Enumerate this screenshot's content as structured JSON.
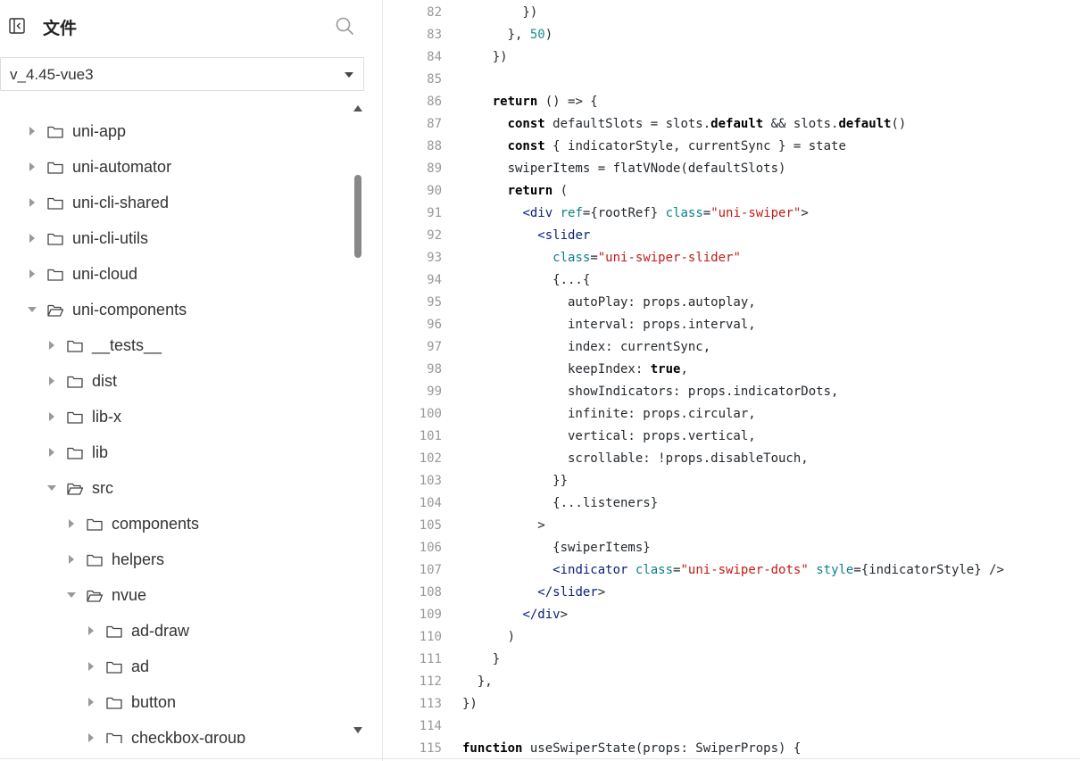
{
  "sidebar": {
    "title": "文件",
    "branch": "v_4.45-vue3",
    "tree": [
      {
        "label": "uni-app",
        "depth": 0,
        "expanded": false
      },
      {
        "label": "uni-automator",
        "depth": 0,
        "expanded": false
      },
      {
        "label": "uni-cli-shared",
        "depth": 0,
        "expanded": false
      },
      {
        "label": "uni-cli-utils",
        "depth": 0,
        "expanded": false
      },
      {
        "label": "uni-cloud",
        "depth": 0,
        "expanded": false
      },
      {
        "label": "uni-components",
        "depth": 0,
        "expanded": true
      },
      {
        "label": "__tests__",
        "depth": 1,
        "expanded": false
      },
      {
        "label": "dist",
        "depth": 1,
        "expanded": false
      },
      {
        "label": "lib-x",
        "depth": 1,
        "expanded": false
      },
      {
        "label": "lib",
        "depth": 1,
        "expanded": false
      },
      {
        "label": "src",
        "depth": 1,
        "expanded": true
      },
      {
        "label": "components",
        "depth": 2,
        "expanded": false
      },
      {
        "label": "helpers",
        "depth": 2,
        "expanded": false
      },
      {
        "label": "nvue",
        "depth": 2,
        "expanded": true
      },
      {
        "label": "ad-draw",
        "depth": 3,
        "expanded": false
      },
      {
        "label": "ad",
        "depth": 3,
        "expanded": false
      },
      {
        "label": "button",
        "depth": 3,
        "expanded": false
      },
      {
        "label": "checkbox-group",
        "depth": 3,
        "expanded": false
      }
    ]
  },
  "code": {
    "lines": [
      {
        "n": "82",
        "t": "        })"
      },
      {
        "n": "83",
        "t": "      }, 50)"
      },
      {
        "n": "84",
        "t": "    })"
      },
      {
        "n": "85",
        "t": ""
      },
      {
        "n": "86",
        "t": "    return () => {"
      },
      {
        "n": "87",
        "t": "      const defaultSlots = slots.default && slots.default()"
      },
      {
        "n": "88",
        "t": "      const { indicatorStyle, currentSync } = state"
      },
      {
        "n": "89",
        "t": "      swiperItems = flatVNode(defaultSlots)"
      },
      {
        "n": "90",
        "t": "      return ("
      },
      {
        "n": "91",
        "t": "        <div ref={rootRef} class=\"uni-swiper\">"
      },
      {
        "n": "92",
        "t": "          <slider"
      },
      {
        "n": "93",
        "t": "            class=\"uni-swiper-slider\""
      },
      {
        "n": "94",
        "t": "            {...{"
      },
      {
        "n": "95",
        "t": "              autoPlay: props.autoplay,"
      },
      {
        "n": "96",
        "t": "              interval: props.interval,"
      },
      {
        "n": "97",
        "t": "              index: currentSync,"
      },
      {
        "n": "98",
        "t": "              keepIndex: true,"
      },
      {
        "n": "99",
        "t": "              showIndicators: props.indicatorDots,"
      },
      {
        "n": "100",
        "t": "              infinite: props.circular,"
      },
      {
        "n": "101",
        "t": "              vertical: props.vertical,"
      },
      {
        "n": "102",
        "t": "              scrollable: !props.disableTouch,"
      },
      {
        "n": "103",
        "t": "            }}"
      },
      {
        "n": "104",
        "t": "            {...listeners}"
      },
      {
        "n": "105",
        "t": "          >"
      },
      {
        "n": "106",
        "t": "            {swiperItems}"
      },
      {
        "n": "107",
        "t": "            <indicator class=\"uni-swiper-dots\" style={indicatorStyle} />"
      },
      {
        "n": "108",
        "t": "          </slider>"
      },
      {
        "n": "109",
        "t": "        </div>"
      },
      {
        "n": "110",
        "t": "      )"
      },
      {
        "n": "111",
        "t": "    }"
      },
      {
        "n": "112",
        "t": "  },"
      },
      {
        "n": "113",
        "t": "})"
      },
      {
        "n": "114",
        "t": ""
      },
      {
        "n": "115",
        "t": "function useSwiperState(props: SwiperProps) {"
      }
    ]
  }
}
